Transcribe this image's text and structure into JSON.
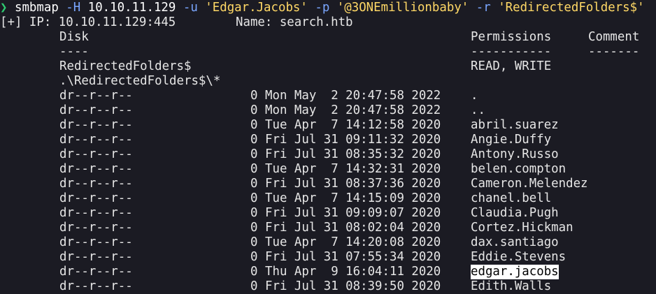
{
  "command": {
    "arrow": "❯",
    "program": "smbmap",
    "flag_host": "-H",
    "host": "10.10.11.129",
    "flag_user": "-u",
    "user": "'Edgar.Jacobs'",
    "flag_pass": "-p",
    "password": "'@3ONEmillionbaby'",
    "flag_recurse": "-r",
    "share_arg": "'RedirectedFolders$'"
  },
  "ip_line": {
    "prefix": "[+] IP: 10.10.11.129:445",
    "name": "Name: search.htb"
  },
  "headers": {
    "disk": "Disk",
    "permissions": "Permissions",
    "comment": "Comment"
  },
  "dividers": {
    "disk": "----",
    "permissions": "-----------",
    "comment": "-------"
  },
  "share": {
    "name": "RedirectedFolders$",
    "permissions": "READ, WRITE",
    "path": ".\\RedirectedFolders$\\*"
  },
  "entries": [
    {
      "perm": "dr--r--r--",
      "size": "0",
      "date": "Mon May  2 20:47:58 2022",
      "name": "."
    },
    {
      "perm": "dr--r--r--",
      "size": "0",
      "date": "Mon May  2 20:47:58 2022",
      "name": ".."
    },
    {
      "perm": "dr--r--r--",
      "size": "0",
      "date": "Tue Apr  7 14:12:58 2020",
      "name": "abril.suarez"
    },
    {
      "perm": "dr--r--r--",
      "size": "0",
      "date": "Fri Jul 31 09:11:32 2020",
      "name": "Angie.Duffy"
    },
    {
      "perm": "dr--r--r--",
      "size": "0",
      "date": "Fri Jul 31 08:35:32 2020",
      "name": "Antony.Russo"
    },
    {
      "perm": "dr--r--r--",
      "size": "0",
      "date": "Tue Apr  7 14:32:31 2020",
      "name": "belen.compton"
    },
    {
      "perm": "dr--r--r--",
      "size": "0",
      "date": "Fri Jul 31 08:37:36 2020",
      "name": "Cameron.Melendez"
    },
    {
      "perm": "dr--r--r--",
      "size": "0",
      "date": "Tue Apr  7 14:15:09 2020",
      "name": "chanel.bell"
    },
    {
      "perm": "dr--r--r--",
      "size": "0",
      "date": "Fri Jul 31 09:09:07 2020",
      "name": "Claudia.Pugh"
    },
    {
      "perm": "dr--r--r--",
      "size": "0",
      "date": "Fri Jul 31 08:02:04 2020",
      "name": "Cortez.Hickman"
    },
    {
      "perm": "dr--r--r--",
      "size": "0",
      "date": "Tue Apr  7 14:20:08 2020",
      "name": "dax.santiago"
    },
    {
      "perm": "dr--r--r--",
      "size": "0",
      "date": "Fri Jul 31 07:55:34 2020",
      "name": "Eddie.Stevens"
    },
    {
      "perm": "dr--r--r--",
      "size": "0",
      "date": "Thu Apr  9 16:04:11 2020",
      "name": "edgar.jacobs",
      "highlight": true
    },
    {
      "perm": "dr--r--r--",
      "size": "0",
      "date": "Fri Jul 31 08:39:50 2020",
      "name": "Edith.Walls"
    }
  ]
}
